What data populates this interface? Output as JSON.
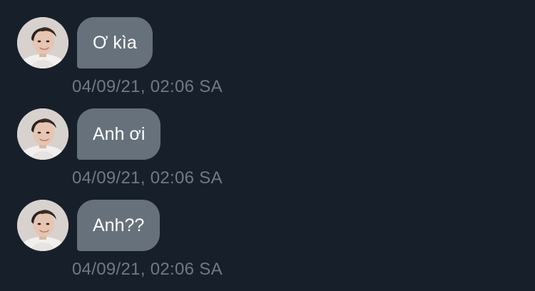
{
  "colors": {
    "background": "#17202a",
    "bubble": "#66717b",
    "bubble_text": "#ffffff",
    "timestamp": "#6f7a84"
  },
  "messages": [
    {
      "text": "Ơ kìa",
      "time": "04/09/21, 02:06 SA",
      "avatar": "avatar-photo"
    },
    {
      "text": "Anh ơi",
      "time": "04/09/21, 02:06 SA",
      "avatar": "avatar-photo"
    },
    {
      "text": "Anh??",
      "time": "04/09/21, 02:06 SA",
      "avatar": "avatar-photo"
    }
  ]
}
